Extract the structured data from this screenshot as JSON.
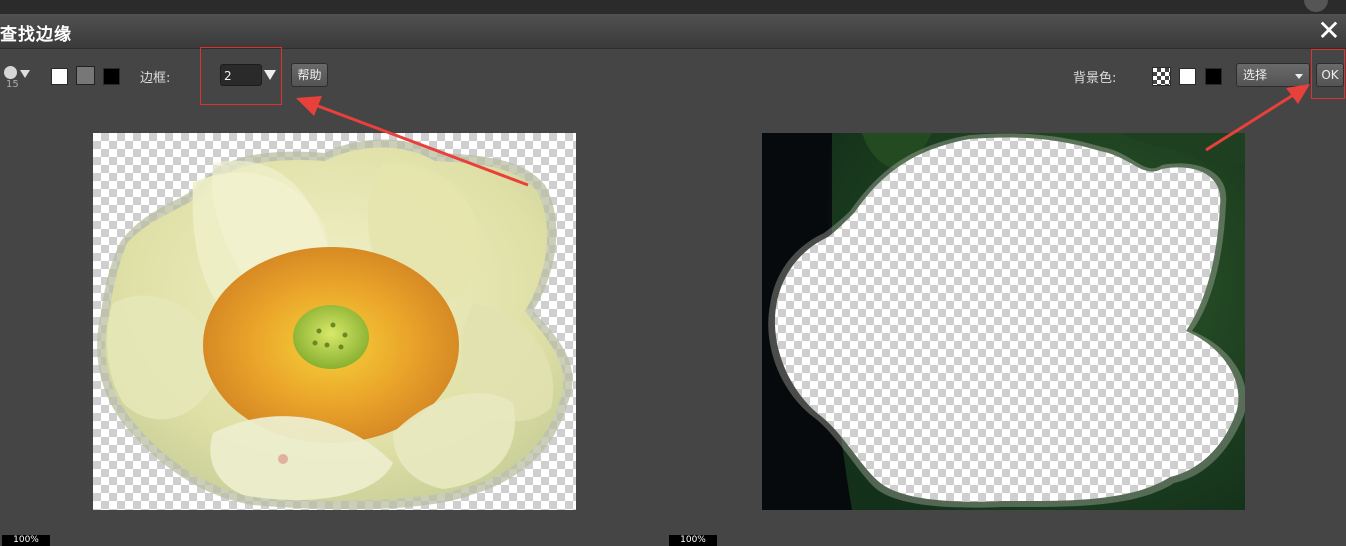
{
  "dialog": {
    "title": "查找边缘",
    "close_icon": "close-icon"
  },
  "toolbar": {
    "brush_size": "15",
    "border_label": "边框:",
    "border_value": "2",
    "help_label": "帮助",
    "background_label": "背景色:",
    "select_label": "选择",
    "ok_label": "OK"
  },
  "left_canvas": {
    "zoom": "100%"
  },
  "right_canvas": {
    "zoom": "100%"
  },
  "colors": {
    "swatch_white": "#ffffff",
    "swatch_gray": "#808080",
    "swatch_black": "#000000",
    "annotation_red": "#e03030"
  }
}
